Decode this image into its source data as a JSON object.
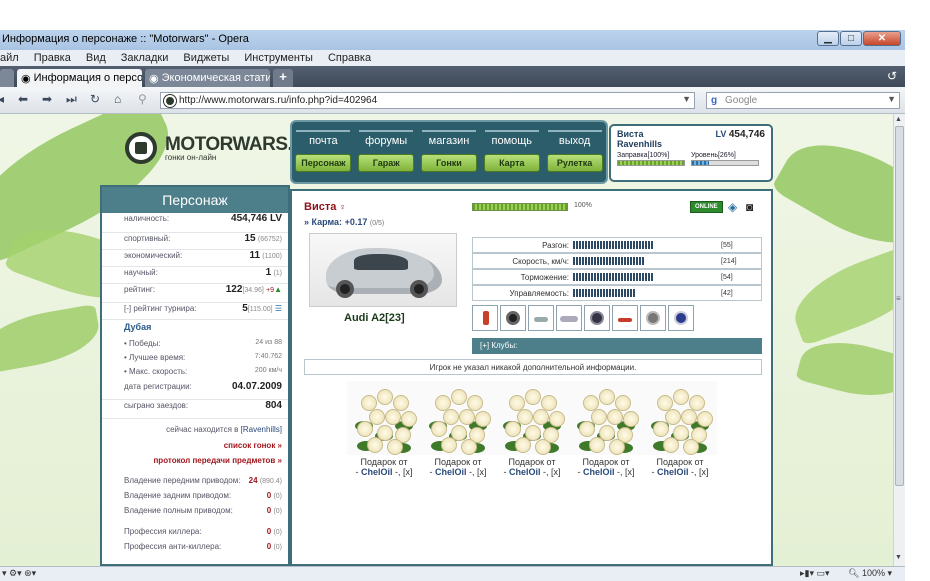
{
  "window": {
    "title": "Информация о персонаже :: \"Motorwars\" - Opera"
  },
  "menu": [
    "айл",
    "Правка",
    "Вид",
    "Закладки",
    "Виджеты",
    "Инструменты",
    "Справка"
  ],
  "tabs": [
    {
      "label": "Информация о персо...",
      "active": true
    },
    {
      "label": "Экономическая стати...",
      "active": false
    }
  ],
  "address": {
    "url": "http://www.motorwars.ru/info.php?id=402964"
  },
  "search": {
    "placeholder": "Google"
  },
  "site": {
    "logo": "MOTORWARS.RU",
    "logo_sub": "гонки он-лайн",
    "top_menu": [
      "почта",
      "форумы",
      "магазин",
      "помощь",
      "выход"
    ],
    "sub_menu": [
      "Персонаж",
      "Гараж",
      "Гонки",
      "Карта",
      "Рулетка"
    ]
  },
  "user": {
    "name": "Виста",
    "login": "Ravenhills",
    "lv_label": "LV",
    "lv": "454,746",
    "fuel_label": "Заправка[100%]",
    "fuel_pct": 100,
    "level_label": "Уровень[26%]",
    "level_pct": 26
  },
  "left": {
    "title": "Персонаж",
    "money_label": "наличность:",
    "money": "454,746 LV",
    "sport_label": "спортивный:",
    "sport": "15",
    "sport_sub": "(66752)",
    "econ_label": "экономический:",
    "econ": "11",
    "econ_sub": "(1100)",
    "sci_label": "научный:",
    "sci": "1",
    "sci_sub": "(1)",
    "rating_label": "рейтинг:",
    "rating": "122",
    "rating_sub": "[34.96]",
    "rating_up": "+9",
    "tour_label": "[-] рейтинг турнира:",
    "tour": "5",
    "tour_sub": "[115.00]",
    "track": "Дубая",
    "wins_label": "Победы:",
    "wins": "24 из 88",
    "best_label": "Лучшее время:",
    "best": "7:40.762",
    "speed_label": "Макс. скорость:",
    "speed": "200 км/ч",
    "reg_label": "дата регистрации:",
    "reg": "04.07.2009",
    "races_label": "сыграно заездов:",
    "races": "804",
    "where_prefix": "сейчас находится в",
    "where": "[Ravenhills]",
    "race_list": "список гонок »",
    "transfer": "протокол передачи предметов »",
    "own": [
      {
        "label": "Владение передним приводом:",
        "value": "24",
        "sub": "(890.4)"
      },
      {
        "label": "Владение задним приводом:",
        "value": "0",
        "sub": "(0)"
      },
      {
        "label": "Владение полным приводом:",
        "value": "0",
        "sub": "(0)"
      },
      {
        "label": "Профессия киллера:",
        "value": "0",
        "sub": "(0)"
      },
      {
        "label": "Профессия анти-киллера:",
        "value": "0",
        "sub": "(0)"
      }
    ]
  },
  "main": {
    "name": "Виста",
    "karma_label": "» Карма:",
    "karma": "+0.17",
    "karma_sub": "(0/5)",
    "hp_text": "100%",
    "online": "ONLINE",
    "car_name": "Audi A2[23]",
    "stats": [
      {
        "label": "Разгон:",
        "value": "[55]",
        "pct": 55
      },
      {
        "label": "Скорость, км/ч:",
        "value": "[214]",
        "pct": 48
      },
      {
        "label": "Торможение:",
        "value": "[54]",
        "pct": 54
      },
      {
        "label": "Управляемость:",
        "value": "[42]",
        "pct": 42
      }
    ],
    "clubs": "[+]  Клубы:",
    "info": "Игрок не указал никакой дополнительной информации.",
    "gifts": [
      {
        "from": "Подарок от",
        "who": "ChelOil",
        "tail": " -, [x]"
      },
      {
        "from": "Подарок от",
        "who": "ChelOil",
        "tail": " -, [x]"
      },
      {
        "from": "Подарок от",
        "who": "ChelOil",
        "tail": " -, [x]"
      },
      {
        "from": "Подарок от",
        "who": "ChelOil",
        "tail": " -, [x]"
      },
      {
        "from": "Подарок от",
        "who": "ChelOil",
        "tail": " -, [x]"
      }
    ]
  },
  "status": {
    "zoom": "100%"
  }
}
